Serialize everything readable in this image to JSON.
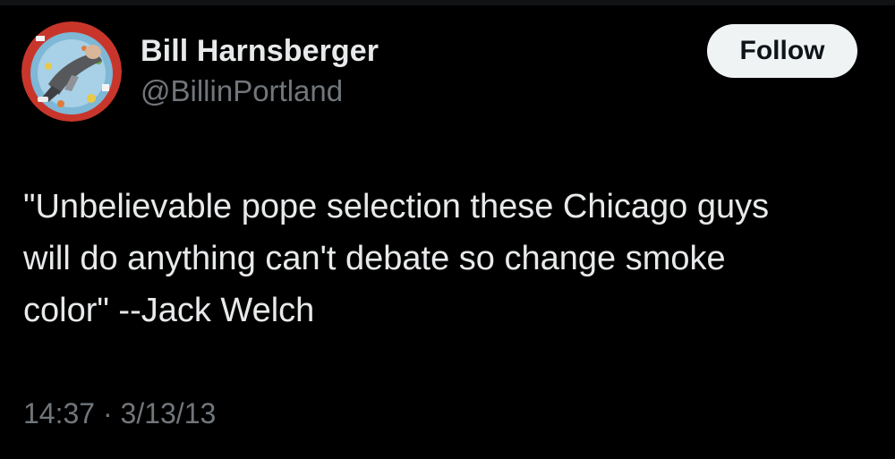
{
  "tweet": {
    "author": {
      "name": "Bill Harnsberger",
      "handle": "@BillinPortland"
    },
    "follow_label": "Follow",
    "text_lines": [
      "\"Unbelievable pope selection these Chicago guys",
      "will do anything can't debate so change smoke",
      "color\" --Jack Welch"
    ],
    "time": "14:37",
    "separator": "·",
    "date": "3/13/13"
  },
  "colors": {
    "background": "#000000",
    "primary_text": "#e7e9ea",
    "secondary_text": "#71767b",
    "follow_button_bg": "#eff3f4",
    "follow_button_text": "#0f1419"
  },
  "icons": {
    "avatar": "profile-photo-person-lying-on-kiddie-pool"
  }
}
